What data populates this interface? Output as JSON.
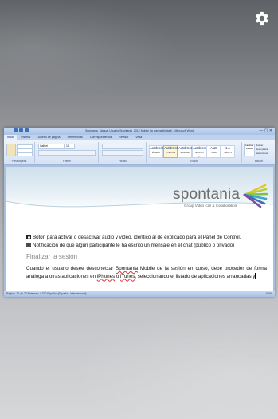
{
  "word": {
    "title": "Spontania_Manual Usuario Spontania_2012 Mobile (la compatibilidad) - Microsoft Word",
    "win_controls": "—  ▢  ✕",
    "tabs": [
      "Inicio",
      "Insertar",
      "Diseño de página",
      "Referencias",
      "Correspondencia",
      "Revisar",
      "Vista"
    ],
    "ribbon": {
      "groups": [
        "Portapapeles",
        "Fuente",
        "Párrafo",
        "Estilos",
        "Edición"
      ],
      "font_name": "Calibri",
      "font_size": "10",
      "styles": [
        {
          "preview": "AaBbCcDd",
          "name": "Énfasis"
        },
        {
          "preview": "AaBbCcDd",
          "name": "¶ Normal"
        },
        {
          "preview": "AaBbCcDd",
          "name": "Subtítulo"
        },
        {
          "preview": "AaBbCcDd",
          "name": "Texto en n..."
        },
        {
          "preview": "AaB",
          "name": "Título"
        },
        {
          "preview": "1 A",
          "name": "Título 1"
        }
      ],
      "change_styles": "Cambiar estilos",
      "edit_items": [
        "Buscar",
        "Reemplazar",
        "Seleccionar"
      ]
    },
    "document": {
      "logo_text": "spontania",
      "logo_sub": "Group Video Call & Collaboration",
      "bullet1": "Botón para activar o desactivar audio y video, idéntico al de explicado para el Panel de Control.",
      "bullet2": "Notificación de que algún participante le ha escrito un mensaje en el chat (público o privado)",
      "section_title": "Finalizar la sesión",
      "para_a": "Cuando el usuario desee desconectar ",
      "para_b": "Spontania",
      "para_c": " Mobile de la sesión en curso, debe proceder de forma análoga a otras aplicaciones en ",
      "para_d": "iPhones",
      "para_e": " o ",
      "para_f": "iTunes",
      "para_g": ", seleccionando el listado de aplicaciones arrancadas y"
    },
    "status": {
      "left": "Página: 21 de 23   Palabras: 4.370   Español (España - internacional)",
      "right": "100%"
    }
  },
  "colors": {
    "accent_blue": "#3d6fb8",
    "ribbon_bg": "#d5e2f4",
    "logo_gray": "#6e6e6e"
  },
  "icons": [
    "gear-icon",
    "power-icon",
    "chat-icon"
  ]
}
